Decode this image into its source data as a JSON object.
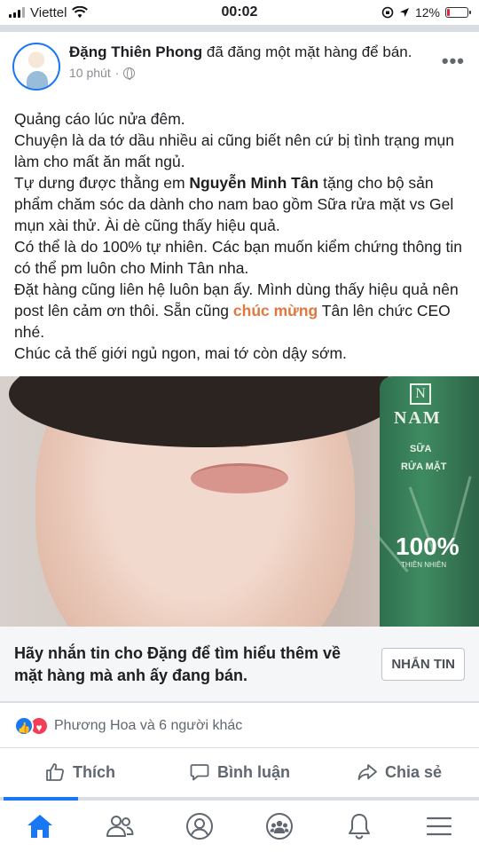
{
  "status_bar": {
    "carrier": "Viettel",
    "time": "00:02",
    "battery": "12%",
    "battery_level": 0.12
  },
  "post": {
    "author": "Đặng Thiên Phong",
    "action_text": "đã đăng một mặt hàng để bán.",
    "time_ago": "10 phút",
    "privacy_icon": "globe-icon",
    "more_icon": "more-icon",
    "body": {
      "line1": "Quảng cáo lúc nửa đêm.",
      "line2": "Chuyện là da tớ dầu nhiều ai cũng biết nên cứ bị tình trạng mụn làm cho mất ăn mất ngủ.",
      "line3_before": "Tự dưng được thằng em ",
      "line3_mention": "Nguyễn Minh Tân",
      "line3_after": " tặng cho bộ sản phẩm chăm sóc da dành cho nam bao gồm Sữa rửa mặt vs Gel mụn xài thử. Ài dè cũng thấy hiệu quả.",
      "line4": "Có thể là do 100% tự nhiên. Các bạn muốn kiểm chứng thông tin có thể pm luôn cho Minh Tân nha.",
      "line5_before": "Đặt hàng cũng liên hệ luôn bạn ấy. Mình dùng thấy hiệu quả nên post lên cảm ơn thôi. Sẵn cũng ",
      "line5_highlight": "chúc mừng",
      "line5_after": " Tân lên chức CEO nhé.",
      "line6": "Chúc cả thế giới ngủ ngon, mai tớ còn dậy sớm."
    },
    "product_image": {
      "brand_letter": "N",
      "brand": "NAM",
      "product_line1": "SỮA",
      "product_line2": "RỬA MẶT",
      "percent": "100%",
      "percent_sub": "THIÊN NHIÊN"
    },
    "cta": {
      "text": "Hãy nhắn tin cho Đặng để tìm hiểu thêm về mặt hàng mà anh ấy đang bán.",
      "button": "NHẮN TIN"
    },
    "reactions": {
      "text": "Phương Hoa và 6 người khác",
      "types": [
        "like",
        "love"
      ]
    },
    "actions": {
      "like": "Thích",
      "comment": "Bình luận",
      "share": "Chia sẻ"
    }
  },
  "bottom_nav": {
    "items": [
      "home-icon",
      "friends-icon",
      "profile-icon",
      "groups-icon",
      "notifications-icon",
      "menu-icon"
    ],
    "active": "home-icon",
    "accent_color": "#1877f2"
  }
}
